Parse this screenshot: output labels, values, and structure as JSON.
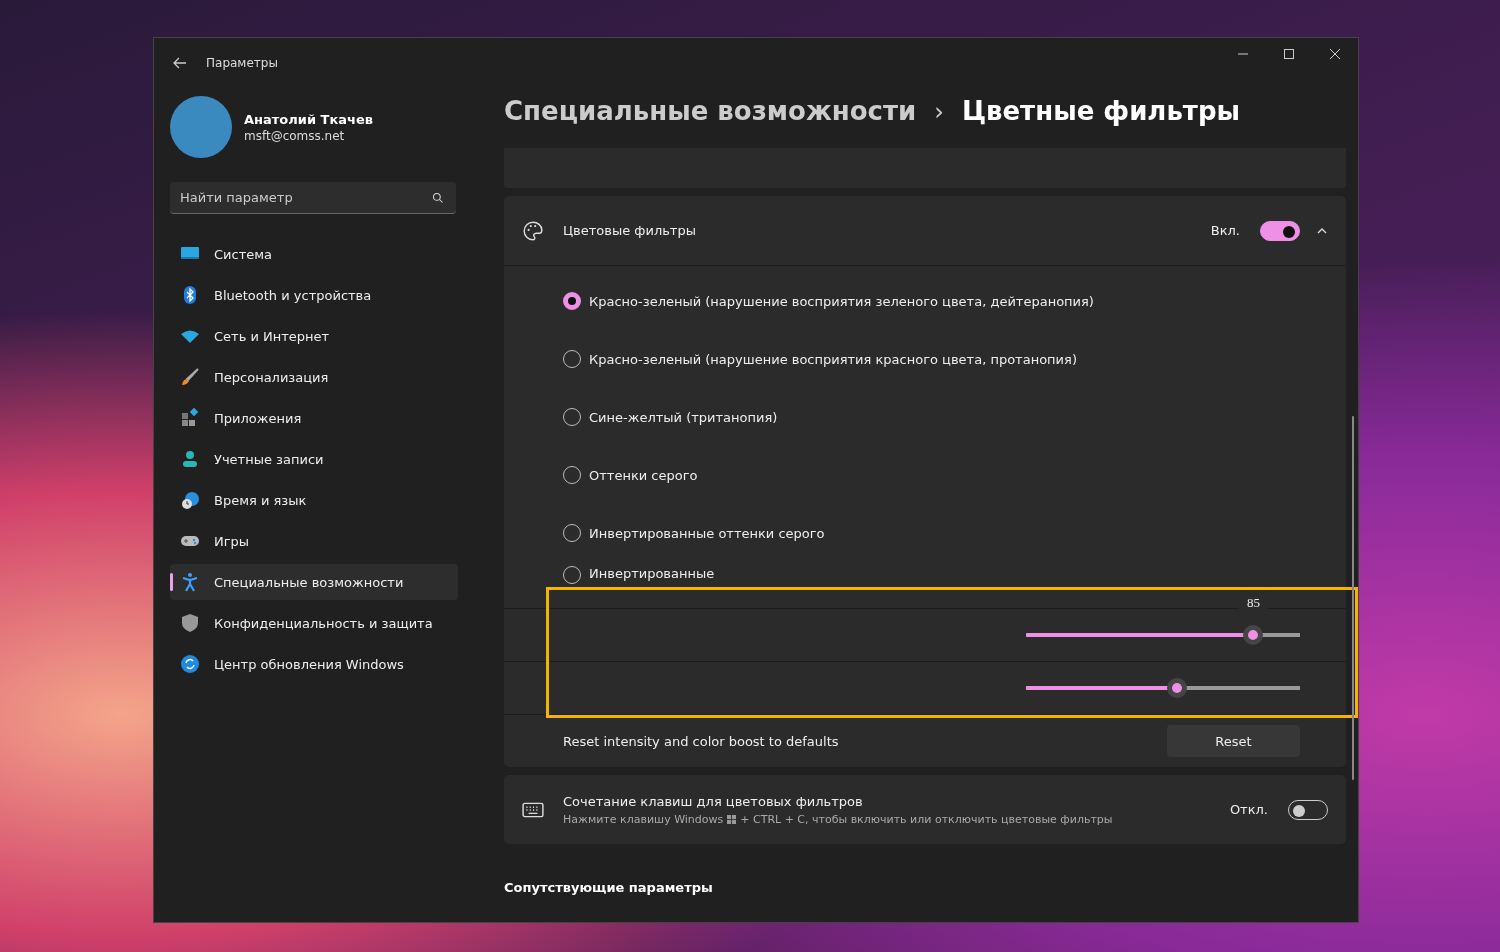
{
  "window": {
    "title": "Параметры"
  },
  "profile": {
    "name": "Анатолий Ткачев",
    "email": "msft@comss.net"
  },
  "search": {
    "placeholder": "Найти параметр"
  },
  "nav": [
    {
      "label": "Система",
      "kind": "system",
      "selected": false
    },
    {
      "label": "Bluetooth и устройства",
      "kind": "bluetooth",
      "selected": false
    },
    {
      "label": "Сеть и Интернет",
      "kind": "network",
      "selected": false
    },
    {
      "label": "Персонализация",
      "kind": "brush",
      "selected": false
    },
    {
      "label": "Приложения",
      "kind": "apps",
      "selected": false
    },
    {
      "label": "Учетные записи",
      "kind": "accounts",
      "selected": false
    },
    {
      "label": "Время и язык",
      "kind": "time",
      "selected": false
    },
    {
      "label": "Игры",
      "kind": "games",
      "selected": false
    },
    {
      "label": "Специальные возможности",
      "kind": "accessibility",
      "selected": true
    },
    {
      "label": "Конфиденциальность и защита",
      "kind": "shield",
      "selected": false
    },
    {
      "label": "Центр обновления Windows",
      "kind": "update",
      "selected": false
    }
  ],
  "breadcrumb": {
    "parent": "Специальные возможности",
    "separator": "›",
    "current": "Цветные фильтры"
  },
  "filters_card": {
    "title": "Цветовые фильтры",
    "state_label": "Вкл.",
    "on": true,
    "expanded": true,
    "options": [
      {
        "label": "Красно-зеленый (нарушение восприятия зеленого цвета, дейтеранопия)",
        "selected": true
      },
      {
        "label": "Красно-зеленый (нарушение восприятия красного цвета, протанопия)",
        "selected": false
      },
      {
        "label": "Сине-желтый (тританопия)",
        "selected": false
      },
      {
        "label": "Оттенки серого",
        "selected": false
      },
      {
        "label": "Инвертированные оттенки серого",
        "selected": false
      },
      {
        "label": "Инвертированные",
        "selected": false
      }
    ],
    "sliders": [
      {
        "level": 0.83,
        "tooltip": "85"
      },
      {
        "level": 0.55
      }
    ],
    "reset": {
      "label": "Reset intensity and color boost to defaults",
      "button": "Reset"
    }
  },
  "shortcut_card": {
    "title": "Сочетание клавиш для цветовых фильтров",
    "hint_before": "Нажмите клавишу Windows",
    "hint_after": "+ CTRL + C, чтобы включить или отключить цветовые фильтры",
    "state_label": "Откл.",
    "on": false
  },
  "related": {
    "title": "Сопутствующие параметры"
  }
}
